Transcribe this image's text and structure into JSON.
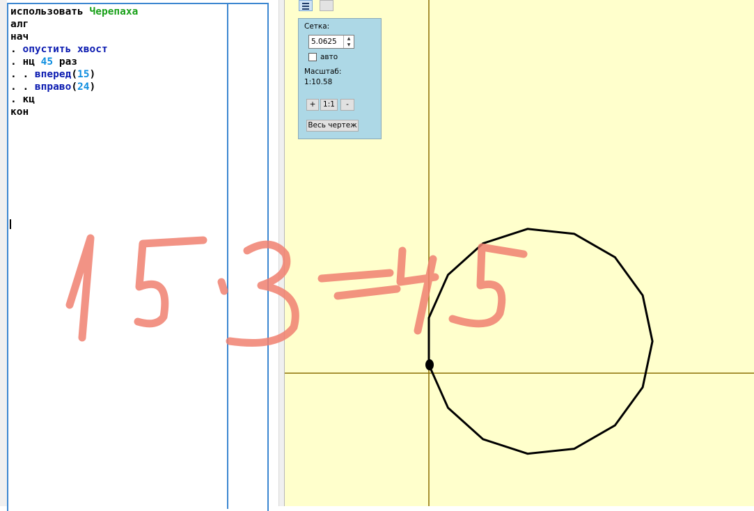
{
  "editor": {
    "lines": [
      [
        {
          "t": "использовать ",
          "c": "plain"
        },
        {
          "t": "Черепаха",
          "c": "kw-green"
        }
      ],
      [
        {
          "t": "алг",
          "c": "plain"
        }
      ],
      [
        {
          "t": "нач",
          "c": "plain"
        }
      ],
      [
        {
          "t": ". ",
          "c": "plain"
        },
        {
          "t": "опустить хвост",
          "c": "kw-blue"
        }
      ],
      [
        {
          "t": ". нц ",
          "c": "plain"
        },
        {
          "t": "45",
          "c": "num"
        },
        {
          "t": " раз",
          "c": "plain"
        }
      ],
      [
        {
          "t": ". . ",
          "c": "plain"
        },
        {
          "t": "вперед",
          "c": "kw-blue"
        },
        {
          "t": "(",
          "c": "plain"
        },
        {
          "t": "15",
          "c": "num"
        },
        {
          "t": ")",
          "c": "plain"
        }
      ],
      [
        {
          "t": ". . ",
          "c": "plain"
        },
        {
          "t": "вправо",
          "c": "kw-blue"
        },
        {
          "t": "(",
          "c": "plain"
        },
        {
          "t": "24",
          "c": "num"
        },
        {
          "t": ")",
          "c": "plain"
        }
      ],
      [
        {
          "t": ". кц",
          "c": "plain"
        }
      ],
      [
        {
          "t": "кон",
          "c": "plain"
        }
      ]
    ]
  },
  "panel": {
    "grid_label": "Сетка:",
    "grid_value": "5.0625",
    "auto_label": "авто",
    "auto_checked": false,
    "scale_label": "Масштаб:",
    "scale_value": "1:10.58",
    "zoom_in_label": "+",
    "zoom_reset_label": "1:1",
    "zoom_out_label": "-",
    "fit_all_label": "Весь чертеж"
  },
  "toolbar": {
    "menu_icon": "hamburger-menu-icon"
  },
  "colors": {
    "canvas_bg": "#ffffcc",
    "axis": "#8a6d00",
    "trace": "#000000",
    "panel_bg": "#add8e6",
    "scribble": "#f08070",
    "editor_border": "#3b86d0"
  },
  "turtle": {
    "step": 15,
    "turn": 24,
    "repeat": 45
  },
  "annotation": "15·3=45"
}
